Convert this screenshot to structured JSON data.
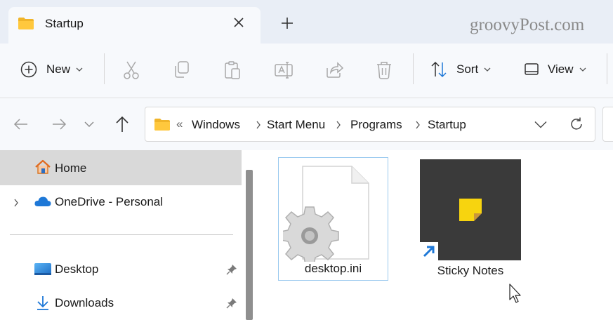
{
  "tab": {
    "title": "Startup",
    "close_icon": "close-icon",
    "new_tab_icon": "plus-icon"
  },
  "watermark": "groovyPost.com",
  "toolbar": {
    "new_label": "New",
    "sort_label": "Sort",
    "view_label": "View",
    "icons": [
      "add-circle-icon",
      "cut-icon",
      "copy-icon",
      "paste-icon",
      "rename-icon",
      "share-icon",
      "delete-icon",
      "sort-icon",
      "view-icon"
    ]
  },
  "address": {
    "overflow": "«",
    "crumbs": [
      "Windows",
      "Start Menu",
      "Programs",
      "Startup"
    ]
  },
  "sidebar": {
    "items": [
      {
        "label": "Home",
        "icon": "home-icon",
        "selected": true
      },
      {
        "label": "OneDrive - Personal",
        "icon": "cloud-icon"
      },
      {
        "label": "Desktop",
        "icon": "desktop-icon",
        "pinned": true
      },
      {
        "label": "Downloads",
        "icon": "download-icon",
        "pinned": true
      }
    ]
  },
  "files": [
    {
      "name": "desktop.ini",
      "icon": "settings-file-icon",
      "selected": true
    },
    {
      "name": "Sticky Notes",
      "icon": "sticky-notes-icon",
      "shortcut": true
    }
  ],
  "colors": {
    "accent": "#1e78d7",
    "sticky_yellow": "#f7d40f",
    "sticky_tile": "#3a3a3a"
  }
}
